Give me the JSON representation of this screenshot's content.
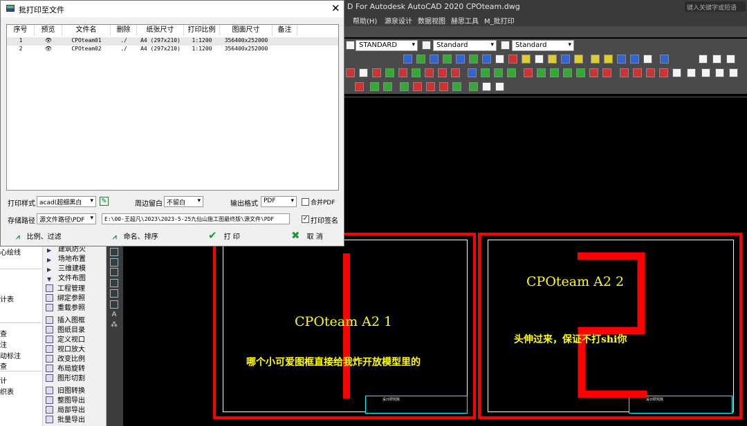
{
  "cad": {
    "title": "D For Autodesk AutoCAD 2020    CPOteam.dwg",
    "search_placeholder": "键入关键字或短语",
    "menus": [
      "帮助(H)",
      "源泉设计",
      "数据视图",
      "赫思工具",
      "M_批打印"
    ],
    "toolbar_dropdowns": [
      "STANDARD",
      "Standard",
      "Standard"
    ]
  },
  "dialog": {
    "title": "批打印至文件",
    "close_glyph": "✕",
    "columns": [
      "序号",
      "预览",
      "文件名",
      "删除",
      "纸张尺寸",
      "打印比例",
      "图面尺寸",
      "备注"
    ],
    "rows": [
      {
        "no": "1",
        "preview": "👁",
        "file": "CPOteam01",
        "del": "./",
        "paper": "A4 (297x210)",
        "scale": "1:1200",
        "size": "356400x252000",
        "note": ""
      },
      {
        "no": "2",
        "preview": "👁",
        "file": "CPOteam02",
        "del": "./",
        "paper": "A4 (297x210)",
        "scale": "1:1200",
        "size": "356400x252000",
        "note": ""
      }
    ],
    "print_style_label": "打印样式",
    "print_style_value": "acad(超细黑白",
    "margin_label": "周边留白",
    "margin_value": "不留白",
    "output_format_label": "输出格式",
    "output_format_value": "PDF",
    "merge_pdf_label": "合并PDF",
    "merge_pdf_checked": false,
    "save_path_label": "存储路径",
    "save_path_mode": "源文件路径\\PDF",
    "save_path_value": "E:\\00-王超凡\\2023\\2023-5-25九仙山施工图最终版\\源文件\\PDF",
    "print_sign_label": "打印签名",
    "print_sign_checked": true,
    "btn_scale_filter": "比例、过滤",
    "btn_rename_sort": "命名、排序",
    "btn_print": "打 印",
    "btn_cancel": "取 消"
  },
  "left_panel": [
    "心绘线",
    "",
    "计表",
    "",
    "查",
    "注",
    "动标注",
    "查",
    "计",
    "织表"
  ],
  "menu_panel": {
    "items": [
      "建筑防火",
      "场地布置",
      "三维建模",
      "文件布图",
      "工程管理",
      "绑定参照",
      "重载参照",
      "插入图框",
      "图纸目录",
      "定义视口",
      "视口放大",
      "改变比例",
      "布局旋转",
      "图形切割",
      "旧图转换",
      "整图导出",
      "局部导出",
      "批量导出"
    ]
  },
  "drawing": {
    "sheet1_title": "CPOteam A2 1",
    "sheet1_text": "哪个小可爱图框直接给我炸开放模型里的",
    "sheet1_big": "1",
    "sheet2_title": "CPOteam A2 2",
    "sheet2_text": "头伸过来，保证不打shi你",
    "sheet2_big": "2",
    "titleblock_text": "设计研究院"
  }
}
